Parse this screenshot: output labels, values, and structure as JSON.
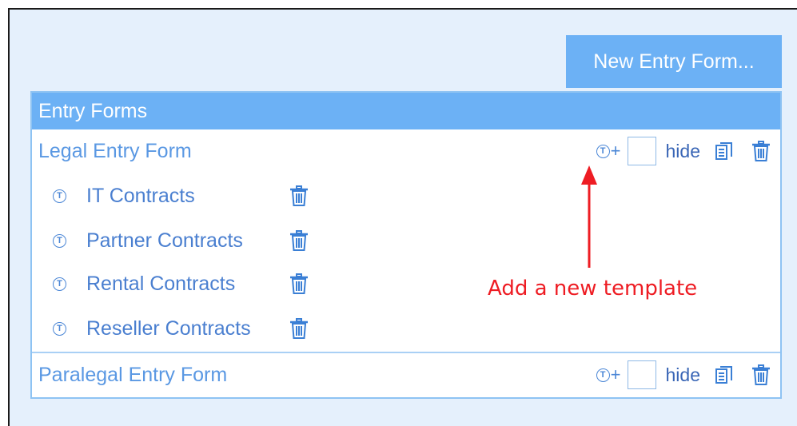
{
  "toolbar": {
    "new_entry_form_label": "New Entry Form..."
  },
  "panel": {
    "header": "Entry Forms"
  },
  "forms": [
    {
      "name": "Legal Entry Form",
      "hide_label": "hide",
      "hidden": false,
      "templates": [
        {
          "name": "IT Contracts"
        },
        {
          "name": "Partner Contracts"
        },
        {
          "name": "Rental Contracts"
        },
        {
          "name": "Reseller Contracts"
        }
      ]
    },
    {
      "name": "Paralegal Entry Form",
      "hide_label": "hide",
      "hidden": false,
      "templates": []
    }
  ],
  "template_icon_letter": "T",
  "add_template_plus": "+",
  "annotation": {
    "text": "Add a new template",
    "color": "#ee1c23"
  },
  "colors": {
    "accent": "#6cb1f5",
    "link": "#5a98e3",
    "background": "#e5f0fc"
  },
  "icons": [
    "template-icon",
    "add-template-icon",
    "copy-icon",
    "trash-icon"
  ]
}
